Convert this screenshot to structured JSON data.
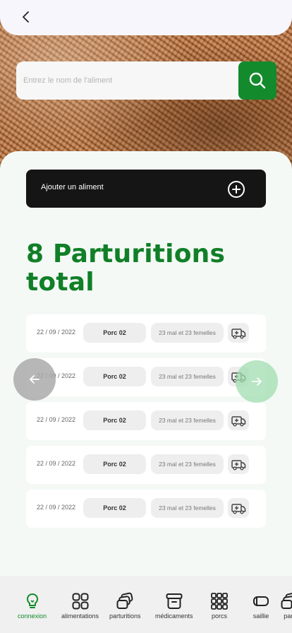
{
  "search": {
    "placeholder": "Entrez le nom de l'aliment"
  },
  "add": {
    "label": "Ajouter un aliment"
  },
  "heading": {
    "title": "8 Parturitions total"
  },
  "rows": [
    {
      "date": "22 / 09 / 2022",
      "name": "Porc 02",
      "count": "23 mal et 23 femelles",
      "icon": "ambulance-icon"
    },
    {
      "date": "22 / 09 / 2022",
      "name": "Porc 02",
      "count": "23 mal et 23 femelles",
      "icon": "ambulance-icon"
    },
    {
      "date": "22 / 09 / 2022",
      "name": "Porc 02",
      "count": "23 mal et 23 femelles",
      "icon": "ambulance-icon"
    },
    {
      "date": "22 / 09 / 2022",
      "name": "Porc 02",
      "count": "23 mal et 23 femelles",
      "icon": "ambulance-icon"
    },
    {
      "date": "22 / 09 / 2022",
      "name": "Porc 02",
      "count": "23 mal et 23 femelles",
      "icon": "ambulance-icon"
    }
  ],
  "tabs": [
    {
      "label": "connexion",
      "icon": "lightbulb-icon",
      "active": true
    },
    {
      "label": "alimentations",
      "icon": "grid-four-icon",
      "active": false
    },
    {
      "label": "parturitions",
      "icon": "layers-icon",
      "active": false
    },
    {
      "label": "médicaments",
      "icon": "archive-box-icon",
      "active": false
    },
    {
      "label": "porcs",
      "icon": "grid-nine-icon",
      "active": false
    },
    {
      "label": "saillie",
      "icon": "capsule-icon",
      "active": false
    },
    {
      "label": "part",
      "icon": "layers-icon",
      "active": false
    }
  ],
  "colors": {
    "accent": "#138a2c",
    "title": "#117f27",
    "dark": "#151515",
    "panel": "#f4f9f6"
  }
}
